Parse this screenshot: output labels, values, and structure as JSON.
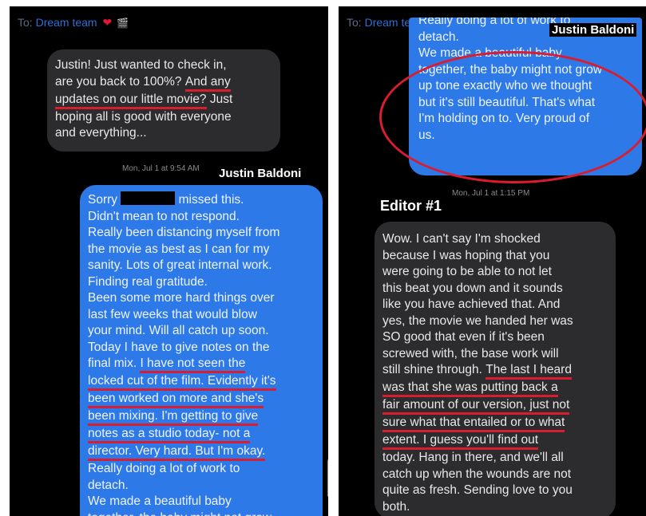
{
  "header": {
    "to_prefix": "To:",
    "team_name": "Dream team",
    "heart_icon": "red-heart",
    "flag_icon": "clapper-board"
  },
  "left": {
    "incoming": [
      {
        "text": "Justin! Just wanted to check in,"
      },
      {
        "text": "are you back to 100%? ",
        "highlight": "And any"
      },
      {
        "highlight": "updates on our little movie?",
        "text": " Just"
      },
      {
        "text": "hoping all is good with everyone"
      },
      {
        "text": "and everything..."
      }
    ],
    "timestamp": "Mon, Jul 1 at 9:54 AM",
    "sender_label": "Justin Baldoni",
    "outgoing": [
      {
        "text": "Sorry ",
        "redacted": true,
        "after": " missed this."
      },
      {
        "text": "Didn't mean to not respond."
      },
      {
        "text": "Really been distancing myself from"
      },
      {
        "text": "the movie as best as I can for my"
      },
      {
        "text": "sanity. Lots of great internal work."
      },
      {
        "text": "Finding real gratitude."
      },
      {
        "text": "Been some more hard things over"
      },
      {
        "text": "last few weeks that would blow"
      },
      {
        "text": "your mind. Will all catch up soon."
      },
      {
        "text": "Today I have to give notes on the"
      },
      {
        "text": "final mix. ",
        "highlight": "I have not seen the"
      },
      {
        "highlight": "locked cut of the film. Evidently it's"
      },
      {
        "highlight": "been worked on more and she's"
      },
      {
        "highlight": "been mixing. I'm getting to give"
      },
      {
        "highlight": "notes as a studio today- not a"
      },
      {
        "highlight": "director. Very hard. But I'm okay."
      },
      {
        "text": "Really doing a lot of work to"
      },
      {
        "text": "detach."
      },
      {
        "text": "We made a beautiful baby"
      },
      {
        "text": "together, the baby might not grow"
      }
    ]
  },
  "right": {
    "sender_label": "Justin Baldoni",
    "outgoing": [
      {
        "text": "Really doing a lot of work to"
      },
      {
        "text": "detach."
      },
      {
        "text": "We made a beautiful baby"
      },
      {
        "text": "together, the baby might not grow"
      },
      {
        "text": "up tone exactly who we thought"
      },
      {
        "text": "but it's still beautiful. That's what"
      },
      {
        "text": "I'm holding on to. Very proud of"
      },
      {
        "text": "us."
      }
    ],
    "timestamp": "Mon, Jul 1 at 1:15 PM",
    "editor_label": "Editor #1",
    "incoming": [
      {
        "text": "Wow. I can't say I'm shocked"
      },
      {
        "text": "because I was hoping that you"
      },
      {
        "text": "were going to be able to not let"
      },
      {
        "text": "this beat you down and it sounds"
      },
      {
        "text": "like you have achieved that. And"
      },
      {
        "text": "yes, the movie we handed her was"
      },
      {
        "text": "SO good that even if it's been"
      },
      {
        "text": "screwed with, the base work will"
      },
      {
        "text": "still shine through. ",
        "highlight": "The last I heard"
      },
      {
        "highlight": "was that she was putting back a"
      },
      {
        "highlight": "fair amount of our version, just not"
      },
      {
        "highlight": "sure what that entailed or to what"
      },
      {
        "highlight": "extent. I guess you'll find out"
      },
      {
        "text": "today. Hang in there, and we'll all"
      },
      {
        "text": "catch up when the wounds are not"
      },
      {
        "text": "quite as fresh. Sending love to you"
      },
      {
        "text": "both."
      }
    ]
  },
  "colors": {
    "background": "#000000",
    "blue_bubble": "#2e79e8",
    "gray_bubble": "#2c2c2e",
    "highlight_underline": "#d91d2e",
    "circle": "#d91d2e",
    "team_link": "#2f6fd6"
  }
}
